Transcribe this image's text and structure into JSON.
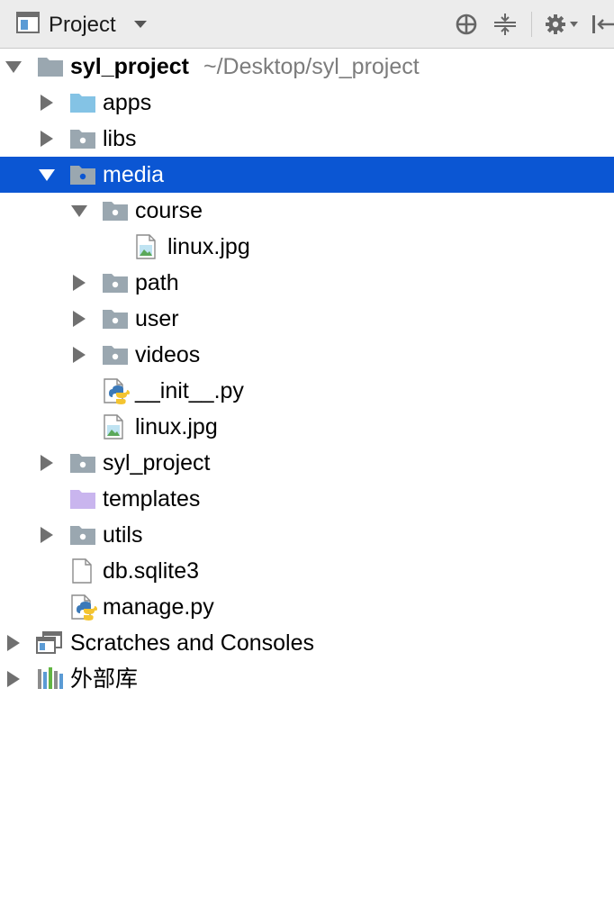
{
  "toolbar": {
    "title": "Project",
    "icons": [
      "project-view-icon",
      "dropdown-caret-icon",
      "locate-icon",
      "collapse-all-icon",
      "gear-icon",
      "hide-panel-icon"
    ]
  },
  "tree": {
    "root": {
      "name": "syl_project",
      "path": "~/Desktop/syl_project"
    },
    "items": [
      {
        "label": "apps",
        "type": "folder-module",
        "expanded": false
      },
      {
        "label": "libs",
        "type": "folder-package",
        "expanded": false
      },
      {
        "label": "media",
        "type": "folder-package",
        "expanded": true,
        "selected": true
      },
      {
        "label": "course",
        "type": "folder-package",
        "expanded": true
      },
      {
        "label": "linux.jpg",
        "type": "image-file"
      },
      {
        "label": "path",
        "type": "folder-package",
        "expanded": false
      },
      {
        "label": "user",
        "type": "folder-package",
        "expanded": false
      },
      {
        "label": "videos",
        "type": "folder-package",
        "expanded": false
      },
      {
        "label": "__init__.py",
        "type": "python-file"
      },
      {
        "label": "linux.jpg",
        "type": "image-file"
      },
      {
        "label": "syl_project",
        "type": "folder-package",
        "expanded": false
      },
      {
        "label": "templates",
        "type": "folder-templates"
      },
      {
        "label": "utils",
        "type": "folder-package",
        "expanded": false
      },
      {
        "label": "db.sqlite3",
        "type": "plain-file"
      },
      {
        "label": "manage.py",
        "type": "python-file"
      },
      {
        "label": "Scratches and Consoles",
        "type": "scratches",
        "expanded": false
      },
      {
        "label": "外部库",
        "type": "libraries",
        "expanded": false
      }
    ]
  },
  "colors": {
    "selection": "#0b56d3",
    "toolbar_bg": "#ececec",
    "folder_gray": "#9aa7b0",
    "folder_blue": "#84c3e5",
    "folder_purple": "#c9b5ee",
    "arrow": "#707070",
    "path_gray": "#7c7c7c"
  }
}
